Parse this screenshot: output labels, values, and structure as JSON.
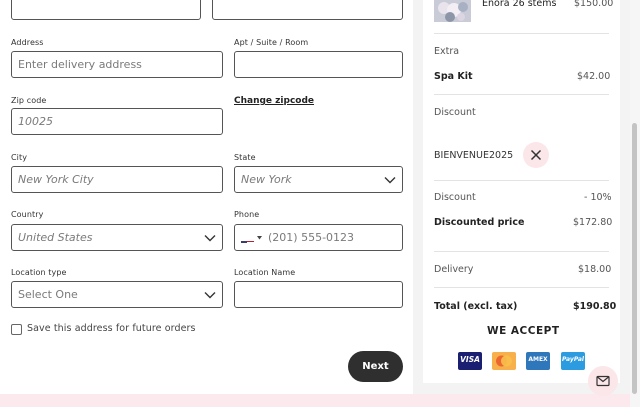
{
  "form": {
    "address": {
      "label": "Address",
      "placeholder": "Enter delivery address"
    },
    "apt": {
      "label": "Apt / Suite / Room",
      "value": ""
    },
    "zipcode": {
      "label": "Zip code",
      "value": "10025",
      "change_link": "Change zipcode"
    },
    "city": {
      "label": "City",
      "value": "New York City"
    },
    "state": {
      "label": "State",
      "value": "New York"
    },
    "country": {
      "label": "Country",
      "value": "United States"
    },
    "phone": {
      "label": "Phone",
      "placeholder": "(201) 555-0123"
    },
    "location_type": {
      "label": "Location type",
      "value": "Select One"
    },
    "location_name": {
      "label": "Location Name",
      "value": ""
    },
    "save_address": {
      "label": "Save this address for future orders",
      "checked": false
    },
    "next_label": "Next"
  },
  "summary": {
    "item": {
      "name": "Enora 26 stems",
      "price": "$150.00"
    },
    "extra": {
      "heading": "Extra",
      "name": "Spa Kit",
      "price": "$42.00"
    },
    "discount_code": {
      "heading": "Discount",
      "code": "BIENVENUE2025"
    },
    "discount": {
      "label": "Discount",
      "value": "- 10%"
    },
    "discounted_price": {
      "label": "Discounted price",
      "value": "$172.80"
    },
    "delivery": {
      "label": "Delivery",
      "value": "$18.00"
    },
    "total": {
      "label": "Total (excl. tax)",
      "value": "$190.80"
    },
    "accept_heading": "WE ACCEPT",
    "cards": [
      "VISA",
      "Mastercard",
      "American Express",
      "PayPal"
    ],
    "card_text": {
      "visa": "VISA",
      "amex": "AMEX",
      "paypal": "PayPal"
    }
  },
  "colors": {
    "accent_pink": "#fbe6ea",
    "button_dark": "#2f2f2f"
  },
  "icons": [
    "chevron-down-icon",
    "close-icon",
    "us-flag-icon",
    "mail-icon"
  ]
}
